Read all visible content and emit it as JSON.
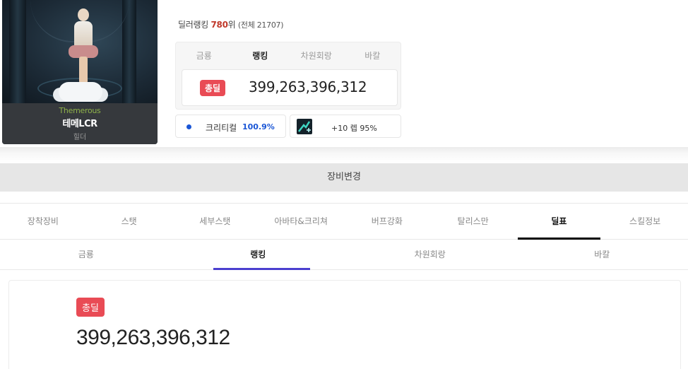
{
  "character": {
    "guild": "Themerous",
    "name": "테메LCR",
    "class": "힐더"
  },
  "ranking": {
    "label": "딜러랭킹",
    "rank": "780",
    "rank_suffix": "위",
    "total": "(전체 21707)"
  },
  "summary_panel": {
    "tabs": [
      "금룡",
      "랭킹",
      "차원회랑",
      "바칼"
    ],
    "badge": "총딜",
    "value": "399,263,396,312"
  },
  "crit": {
    "label": "크리티컬",
    "value": "100.9%"
  },
  "buff": {
    "text": "+10 렙 95%"
  },
  "change_equipment": "장비변경",
  "main_tabs": [
    "장착장비",
    "스탯",
    "세부스탯",
    "아바타&크리쳐",
    "버프강화",
    "탈리스만",
    "딜표",
    "스킬정보"
  ],
  "sub_tabs": [
    "금룡",
    "랭킹",
    "차원회랑",
    "바칼"
  ],
  "result": {
    "badge": "총딜",
    "value": "399,263,396,312"
  },
  "colors": {
    "badge": "#e94b55",
    "rank": "#c0392b",
    "crit": "#1a56d6",
    "sub_tab_indicator": "#4b3fcf"
  }
}
